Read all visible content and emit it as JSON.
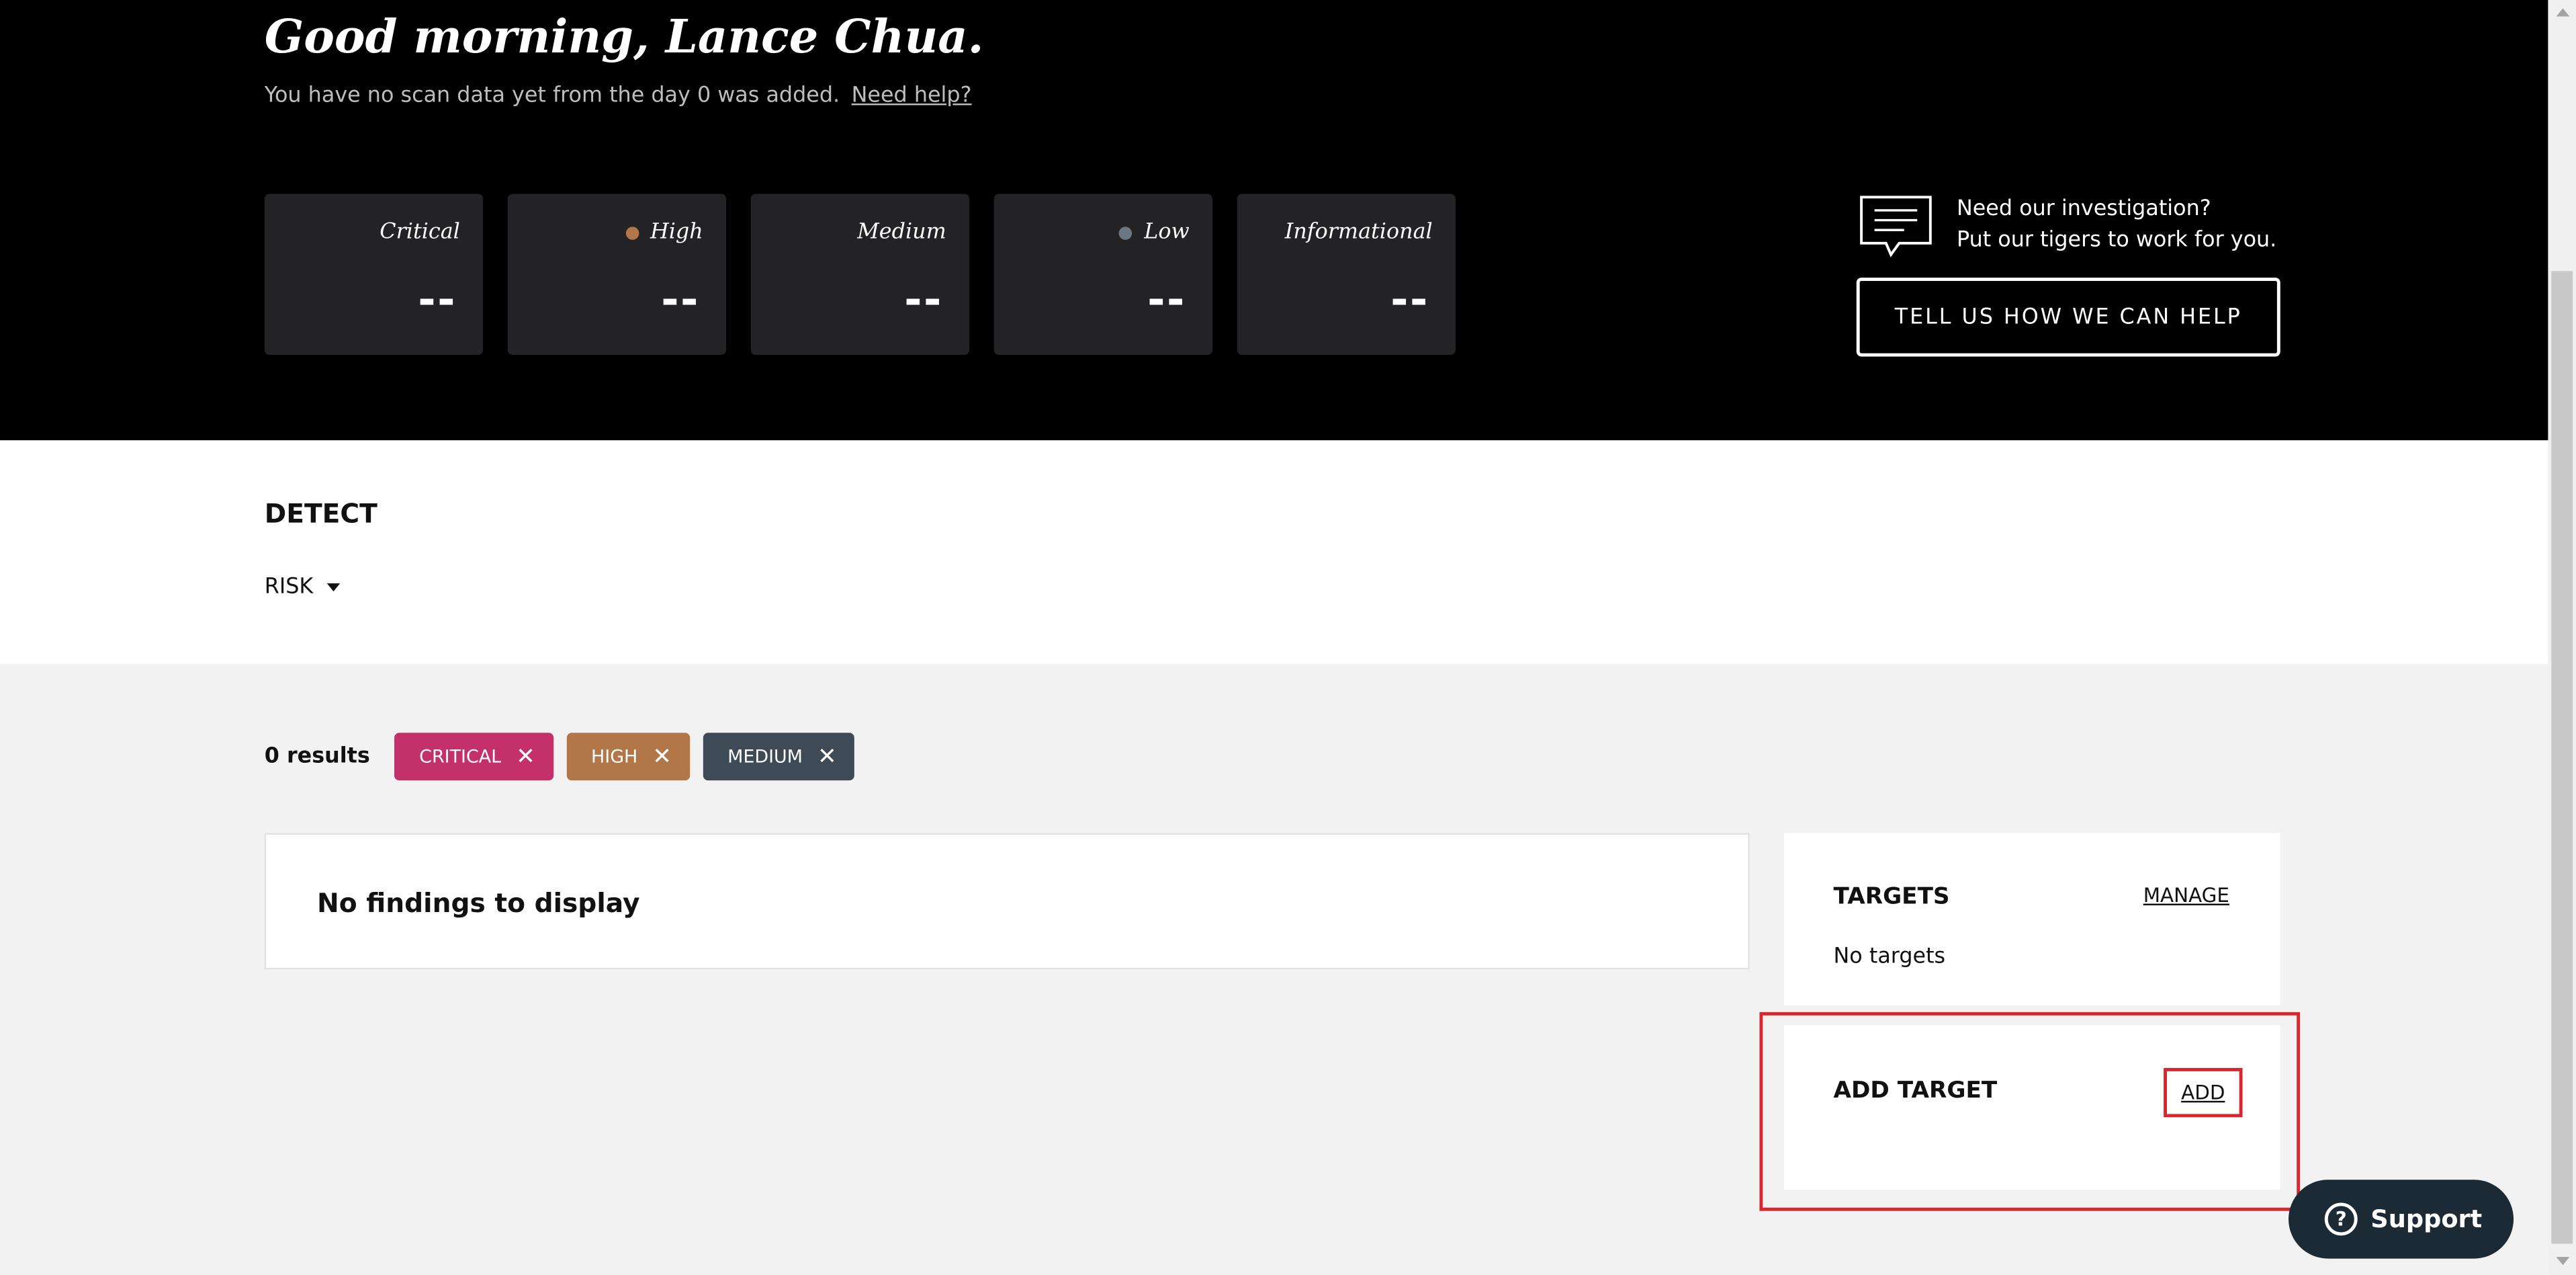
{
  "hero": {
    "greeting": "Good morning, Lance Chua.",
    "subtitle": "You have no scan data yet from the day 0 was added.",
    "help_link": "Need help?",
    "cards": [
      {
        "label": "Critical",
        "value": "--",
        "dot": null
      },
      {
        "label": "High",
        "value": "--",
        "dot": "#b27748"
      },
      {
        "label": "Medium",
        "value": "--",
        "dot": null
      },
      {
        "label": "Low",
        "value": "--",
        "dot": "#6b7783"
      },
      {
        "label": "Informational",
        "value": "--",
        "dot": null
      }
    ],
    "investigation_line1": "Need our investigation?",
    "investigation_line2": "Put our tigers to work for you.",
    "help_button": "TELL US HOW WE CAN HELP",
    "icons": {
      "investigation": "chat-bubble-icon"
    }
  },
  "detect": {
    "title": "DETECT",
    "risk_label": "RISK"
  },
  "results": {
    "count_label": "0 results",
    "chips": [
      {
        "label": "CRITICAL",
        "color": "#c4306a"
      },
      {
        "label": "HIGH",
        "color": "#b27748"
      },
      {
        "label": "MEDIUM",
        "color": "#3e4a56"
      }
    ]
  },
  "findings": {
    "empty_label": "No findings to display"
  },
  "targets": {
    "title": "TARGETS",
    "manage_link": "MANAGE",
    "empty_label": "No targets"
  },
  "add_target": {
    "title": "ADD TARGET",
    "add_link": "ADD"
  },
  "support": {
    "label": "Support",
    "icon": "question-icon"
  }
}
